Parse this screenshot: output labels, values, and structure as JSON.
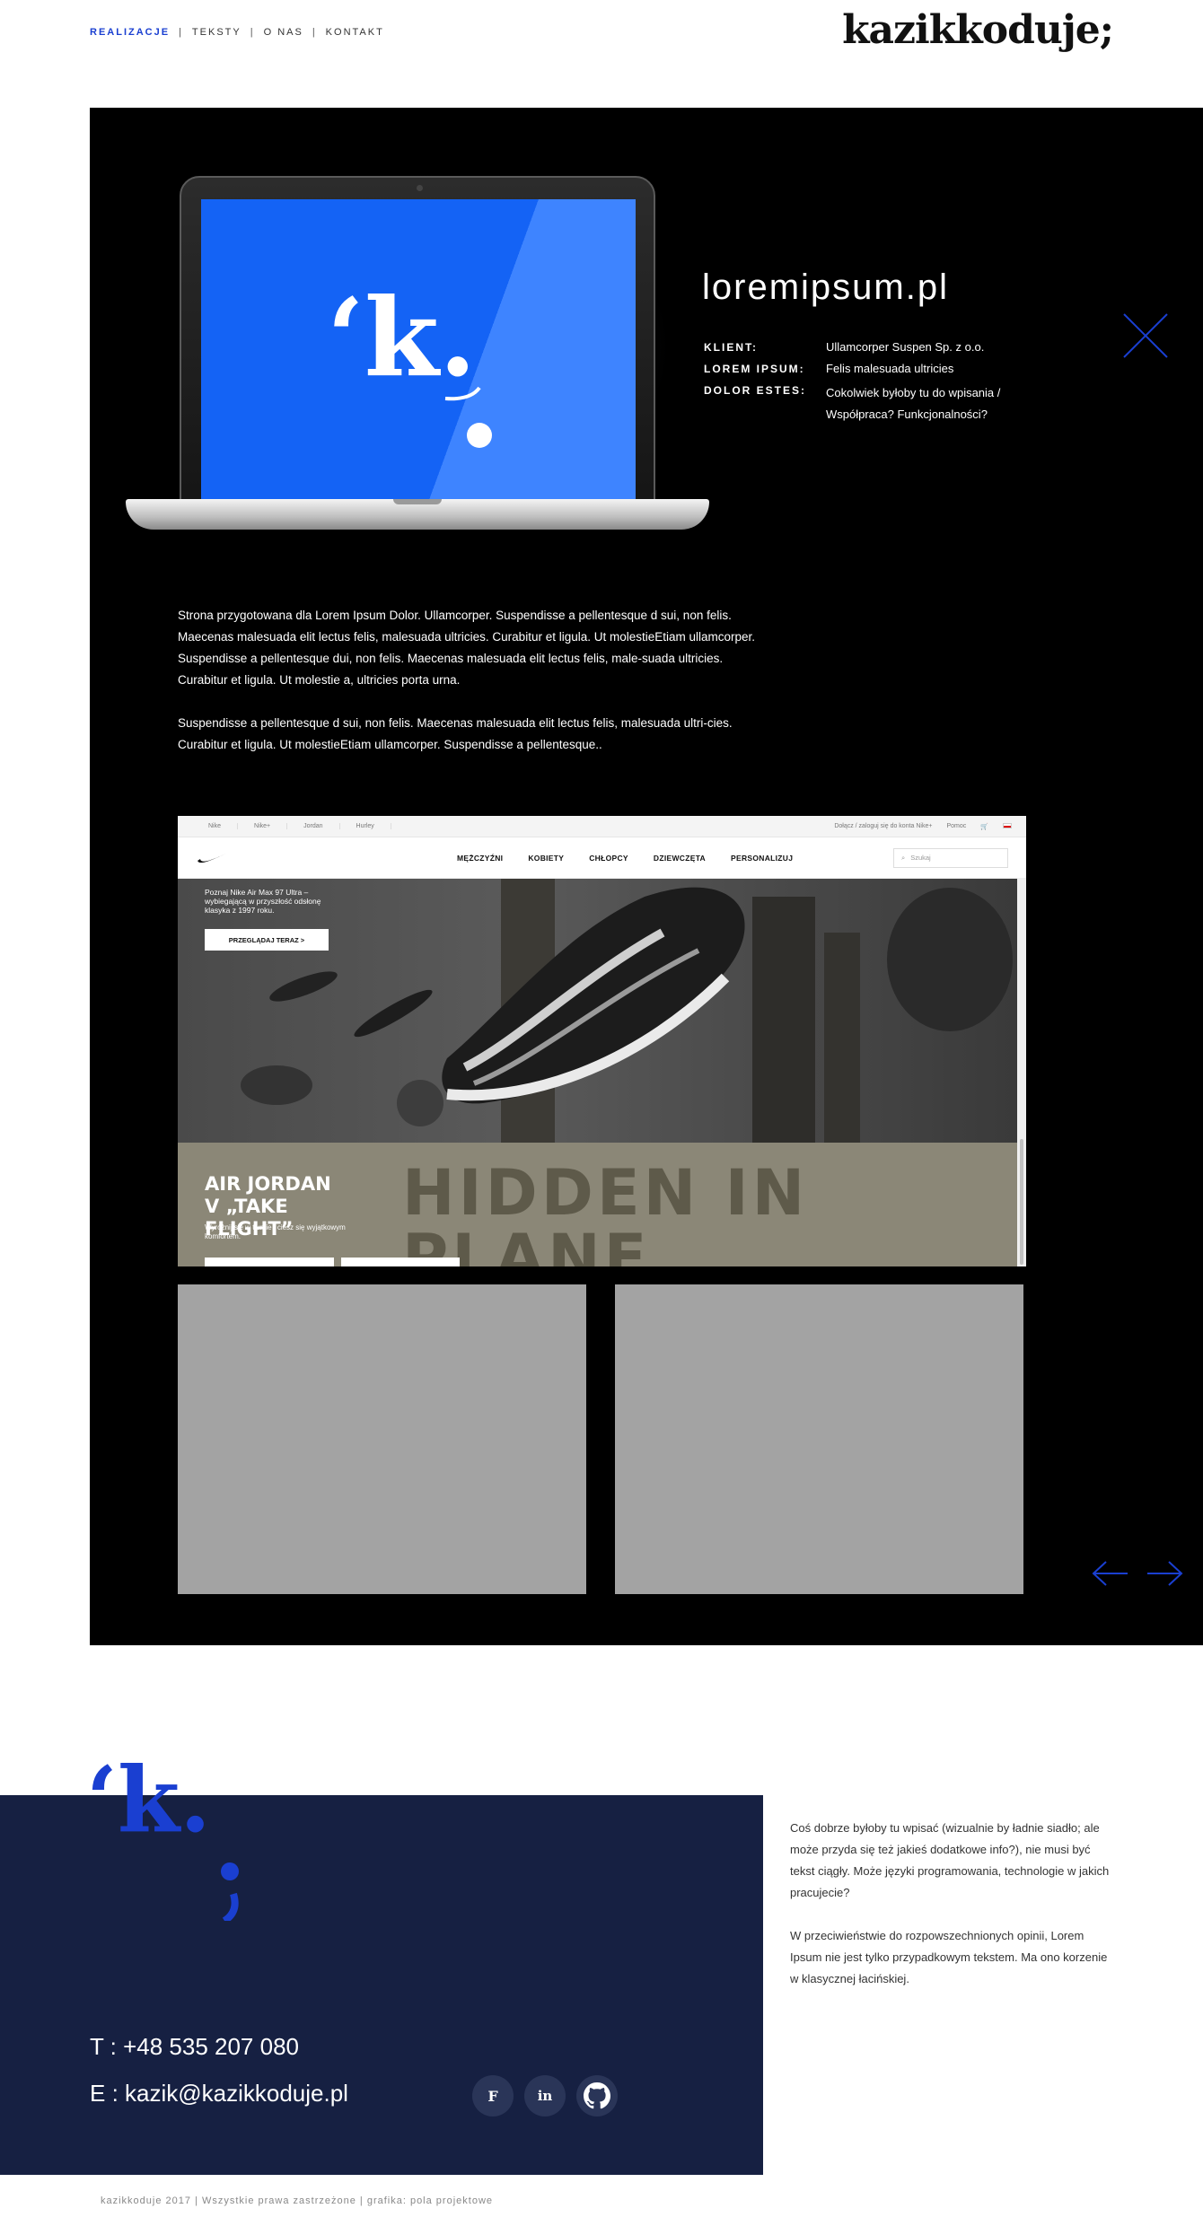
{
  "nav": {
    "items": [
      {
        "label": "REALIZACJE",
        "active": true
      },
      {
        "label": "TEKSTY",
        "active": false
      },
      {
        "label": "O NAS",
        "active": false
      },
      {
        "label": "KONTAKT",
        "active": false
      }
    ]
  },
  "logo": {
    "text": "kazikkoduje;"
  },
  "project": {
    "title": "loremipsum.pl",
    "screen_logo": "‘k.",
    "meta": [
      {
        "key": "KLIENT:",
        "value": "Ullamcorper Suspen Sp. z o.o."
      },
      {
        "key": "LOREM IPSUM:",
        "value": "Felis malesuada ultricies"
      },
      {
        "key": "DOLOR ESTES:",
        "value": "Cokolwiek byłoby tu do wpisania / Współpraca? Funkcjonalności?"
      }
    ],
    "description": [
      "Strona przygotowana dla Lorem Ipsum Dolor.  Ullamcorper. Suspendisse a pellentesque d sui, non felis. Maecenas malesuada elit lectus felis, malesuada ultricies. Curabitur et ligula. Ut molestieEtiam ullamcorper. Suspendisse a pellentesque dui, non felis. Maecenas malesuada elit lectus felis, male-suada ultricies. Curabitur et ligula. Ut molestie a, ultricies porta urna.",
      "Suspendisse a pellentesque d sui, non felis. Maecenas malesuada elit lectus felis, malesuada ultri-cies. Curabitur et ligula. Ut molestieEtiam ullamcorper. Suspendisse a pellentesque.."
    ]
  },
  "nike": {
    "top_brands": [
      "Nike",
      "Nike+",
      "Jordan",
      "Hurley"
    ],
    "top_right": [
      "Dołącz / zaloguj się do konta Nike+",
      "Pomoc"
    ],
    "menu": [
      "MĘŻCZYŹNI",
      "KOBIETY",
      "CHŁOPCY",
      "DZIEWCZĘTA",
      "PERSONALIZUJ"
    ],
    "search_placeholder": "Szukaj",
    "hero_text": "Poznaj Nike Air Max 97 Ultra – wybiegającą w przyszłość odsłonę klasyka z 1997 roku.",
    "hero_button": "PRZEGLĄDAJ TERAZ  >",
    "promo_big": "HIDDEN IN PLANE SIGHT",
    "promo_title": "AIR JORDAN V „TAKE FLIGHT”",
    "promo_sub": "Wyróżnij się w tłumie i ciesz się wyjątkowym komfortem."
  },
  "footer": {
    "logo_text": "‘k.",
    "phone": "T : +48 535 207 080",
    "email": "E : kazik@kazikkoduje.pl",
    "socials": [
      {
        "name": "facebook",
        "label": "F"
      },
      {
        "name": "linkedin",
        "label": "in"
      },
      {
        "name": "github",
        "label": ""
      }
    ],
    "about": [
      "Coś dobrze byłoby tu wpisać (wizualnie by ładnie siadło; ale może przyda się też jakieś dodatkowe info?), nie musi być tekst ciągły. Może języki programowania, technologie w jakich pracujecie?",
      "W przeciwieństwie do rozpowszechnionych opinii, Lorem Ipsum nie jest tylko przypadkowym tekstem. Ma ono korzenie w klasycznej łacińskiej."
    ],
    "copyright": "kazikkoduje 2017 |  Wszystkie prawa zastrzeżone   |   grafika: pola projektowe"
  },
  "colors": {
    "accent": "#1a3fd1",
    "panel": "#000000",
    "footer": "#162042",
    "placeholder": "#a3a3a3"
  }
}
